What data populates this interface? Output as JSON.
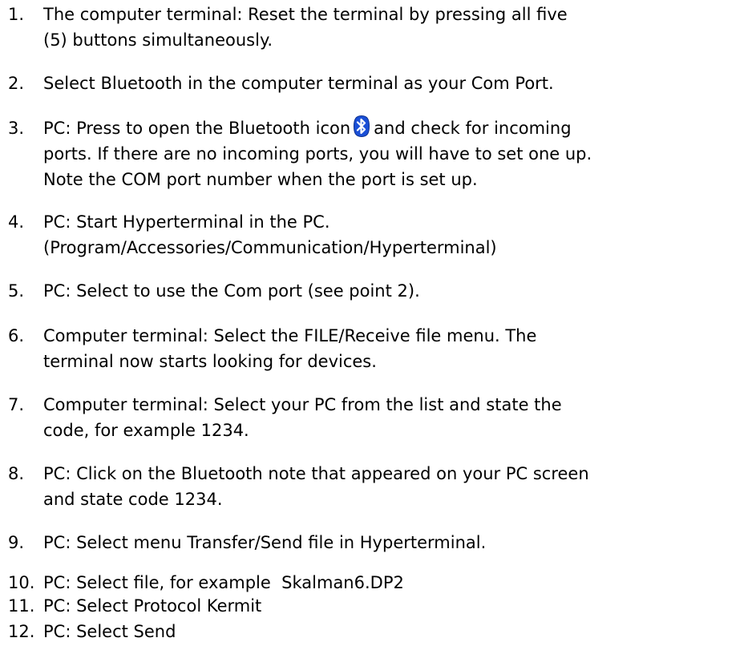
{
  "steps": [
    {
      "number": "1.",
      "lines": [
        "The computer terminal: Reset the terminal by pressing all five",
        "(5) buttons simultaneously."
      ]
    },
    {
      "number": "2.",
      "lines": [
        "Select Bluetooth in the computer terminal as your Com Port."
      ]
    },
    {
      "number": "3.",
      "line1_before_icon": "PC: Press to open the Bluetooth icon",
      "line1_after_icon": "and check for incoming",
      "lines": [
        "ports. If there are no incoming ports, you will have to set one up.",
        "Note the COM port number when the port is set up."
      ],
      "icon": "bluetooth-icon"
    },
    {
      "number": "4.",
      "lines": [
        "PC: Start Hyperterminal in the PC.",
        "(Program/Accessories/Communication/Hyperterminal)"
      ]
    },
    {
      "number": "5.",
      "lines": [
        "PC: Select to use the Com port (see point 2)."
      ]
    },
    {
      "number": "6.",
      "lines": [
        "Computer terminal: Select the FILE/Receive file menu. The",
        "terminal now starts looking for devices."
      ]
    },
    {
      "number": "7.",
      "lines": [
        "Computer terminal: Select your PC from the list and state the",
        "code, for example 1234."
      ]
    },
    {
      "number": "8.",
      "lines": [
        "PC: Click on the Bluetooth note that appeared on your PC screen",
        "and state code 1234."
      ]
    },
    {
      "number": "9.",
      "lines": [
        "PC: Select menu Transfer/Send file in Hyperterminal."
      ]
    },
    {
      "number": "10.",
      "lines": [
        "PC: Select file, for example  Skalman6.DP2"
      ]
    },
    {
      "number": "11.",
      "lines": [
        "PC: Select Protocol Kermit"
      ]
    },
    {
      "number": "12.",
      "lines": [
        "PC: Select Send"
      ]
    }
  ],
  "colors": {
    "text": "#000000",
    "background": "#ffffff",
    "bluetooth_icon_fill": "#1a4fd6",
    "bluetooth_icon_symbol": "#ffffff"
  }
}
